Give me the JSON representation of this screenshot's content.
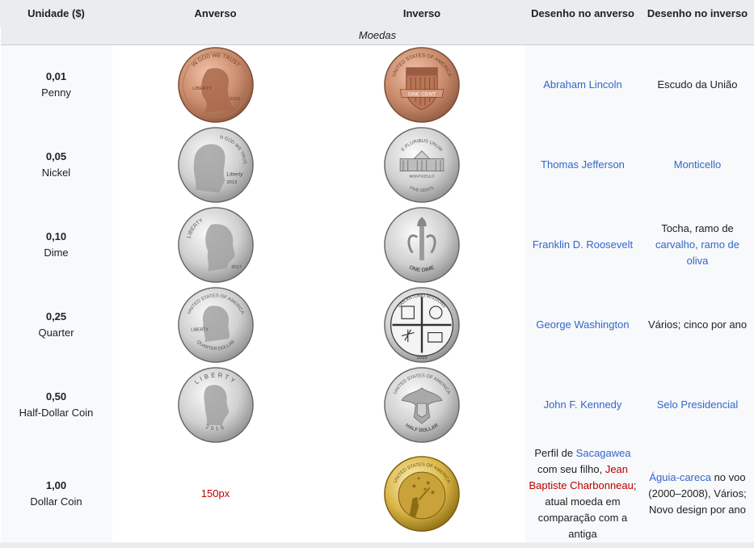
{
  "headers": [
    "Unidade ($)",
    "Anverso",
    "Inverso",
    "Desenho no anverso",
    "Desenho no inverso"
  ],
  "section": "Moedas",
  "rows": [
    {
      "value": "0,01",
      "name": "Penny",
      "obverse_coin": {
        "color": "#c98a6b",
        "icon": "lincoln-cent-obverse-icon"
      },
      "reverse_coin": {
        "color": "#c98a6b",
        "icon": "union-shield-reverse-icon"
      },
      "obverse_design": "Abraham Lincoln",
      "reverse_design": "Escudo da União"
    },
    {
      "value": "0,05",
      "name": "Nickel",
      "obverse_coin": {
        "color": "#d4d4d4",
        "icon": "jefferson-nickel-obverse-icon"
      },
      "reverse_coin": {
        "color": "#d4d4d4",
        "icon": "monticello-reverse-icon"
      },
      "obverse_design": "Thomas Jefferson",
      "reverse_design": "Monticello"
    },
    {
      "value": "0,10",
      "name": "Dime",
      "obverse_coin": {
        "color": "#d4d4d4",
        "icon": "roosevelt-dime-obverse-icon"
      },
      "reverse_coin": {
        "color": "#d4d4d4",
        "icon": "torch-branches-reverse-icon"
      },
      "obverse_design": "Franklin D. Roosevelt",
      "reverse_design_prefix": "Tocha, ramo de",
      "reverse_design_link": "carvalho, ramo de oliva"
    },
    {
      "value": "0,25",
      "name": "Quarter",
      "obverse_coin": {
        "color": "#d4d4d4",
        "icon": "washington-quarter-obverse-icon"
      },
      "reverse_coin": {
        "color": "#d4d4d4",
        "icon": "san-antonio-missions-reverse-icon"
      },
      "obverse_design": "George Washington",
      "reverse_design": "Vários; cinco por ano"
    },
    {
      "value": "0,50",
      "name": "Half-Dollar Coin",
      "obverse_coin": {
        "color": "#d4d4d4",
        "icon": "kennedy-half-obverse-icon"
      },
      "reverse_coin": {
        "color": "#d4d4d4",
        "icon": "presidential-seal-reverse-icon"
      },
      "obverse_design": "John F. Kennedy",
      "reverse_design": "Selo Presidencial"
    },
    {
      "value": "1,00",
      "name": "Dollar Coin",
      "obverse_text": "150px",
      "reverse_coin": {
        "color": "#d9b545",
        "icon": "native-american-dollar-reverse-icon"
      },
      "obverse_design_parts": [
        "Perfil de ",
        "Sacagawea",
        " com seu filho, ",
        "Jean Baptiste Charbonneau",
        "; atual moeda em comparação com a antiga"
      ],
      "reverse_design_link": "Águia-careca",
      "reverse_design_rest": " no voo (2000–2008), Vários; Novo design por ano"
    }
  ],
  "coin_labels": {
    "penny_obv_top": "IN GOD WE TRUST",
    "penny_obv_left": "LIBERTY",
    "penny_obv_year": "2013",
    "penny_rev_top": "UNITED STATES OF AMERICA",
    "penny_rev_banner": "ONE CENT",
    "nickel_obv_top": "IN GOD WE TRUST",
    "nickel_obv_sig": "Liberty",
    "nickel_obv_year": "2013",
    "nickel_rev_top": "E PLURIBUS UNUM",
    "nickel_rev_mid": "MONTICELLO",
    "nickel_rev_bottom": "FIVE CENTS",
    "dime_obv_left": "LIBERTY",
    "dime_obv_year": "2017",
    "dime_rev_bottom": "ONE DIME",
    "quarter_obv_top": "UNITED STATES OF AMERICA",
    "quarter_obv_left": "LIBERTY",
    "quarter_obv_bottom": "QUARTER DOLLAR",
    "quarter_rev_top": "SAN ANTONIO MISSIONS",
    "quarter_rev_year": "2019",
    "half_obv_top": "LIBERTY",
    "half_obv_year": "2015",
    "half_rev_top": "UNITED STATES OF AMERICA",
    "half_rev_bottom": "HALF DOLLAR",
    "dollar_rev_top": "UNITED STATES OF AMERICA"
  }
}
